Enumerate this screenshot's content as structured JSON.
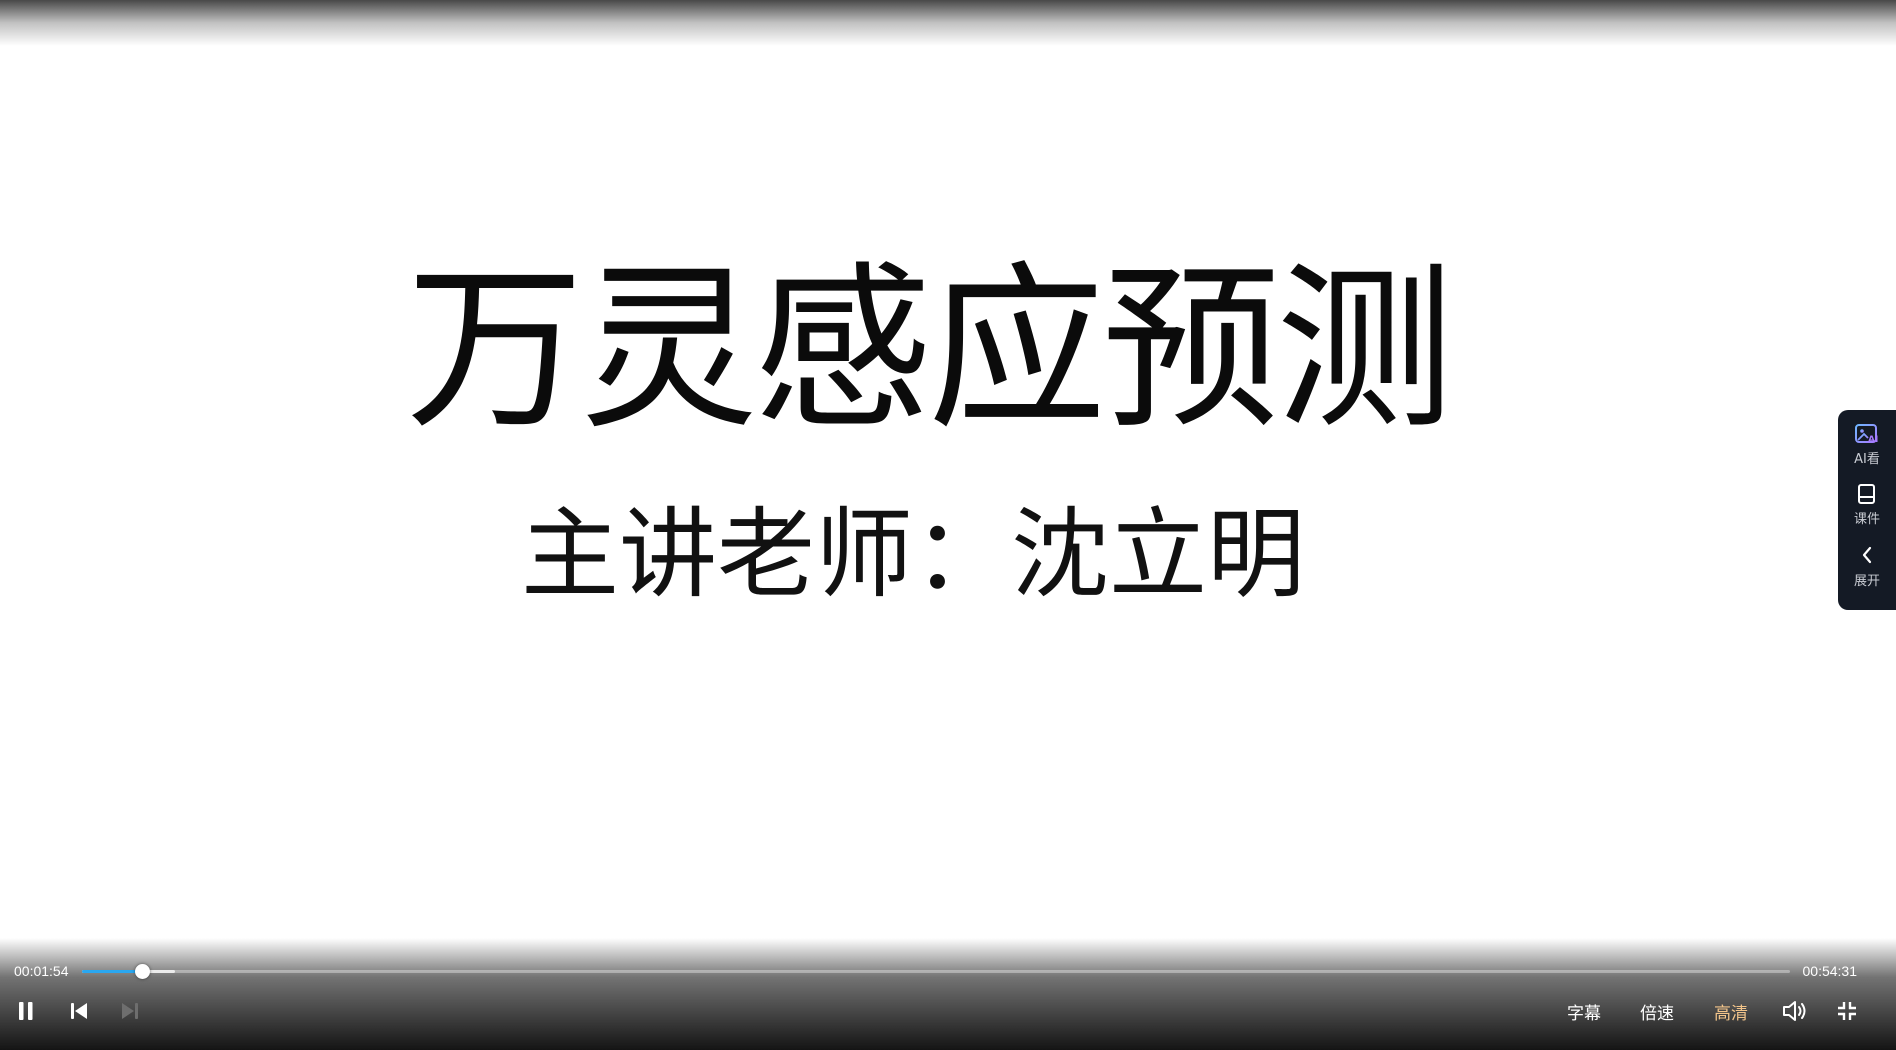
{
  "slide": {
    "title": "万灵感应预测",
    "subtitle": "主讲老师：沈立明"
  },
  "side_panel": {
    "items": [
      {
        "label": "AI看",
        "icon": "ai-image-icon"
      },
      {
        "label": "课件",
        "icon": "courseware-icon"
      },
      {
        "label": "展开",
        "icon": "chevron-left-icon"
      }
    ]
  },
  "player": {
    "current_time": "00:01:54",
    "total_time": "00:54:31",
    "progress_fraction": 0.0349,
    "buffered_fraction": 0.0545,
    "subtitle_label": "字幕",
    "speed_label": "倍速",
    "quality_label": "高清",
    "accent_color": "#2aa7f0",
    "quality_color": "#f3c58b",
    "icons": [
      "pause-icon",
      "previous-icon",
      "next-icon",
      "volume-icon",
      "exit-fullscreen-icon"
    ]
  }
}
